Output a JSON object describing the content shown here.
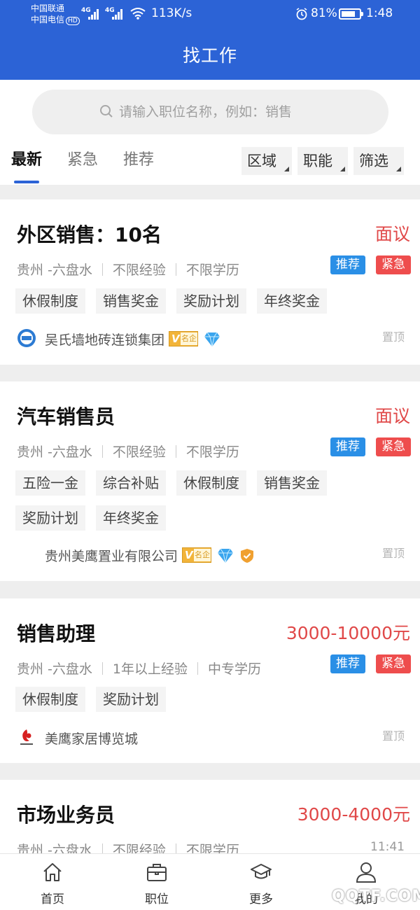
{
  "status_bar": {
    "carrier1": "中国联通",
    "carrier2": "中国电信",
    "hd": "HD",
    "net1": "4G",
    "net2": "4G",
    "speed": "113K/s",
    "battery_pct": "81%",
    "battery_level": 0.81,
    "time": "1:48"
  },
  "header": {
    "title": "找工作"
  },
  "search": {
    "placeholder": "请输入职位名称，例如：销售"
  },
  "tabs": [
    {
      "label": "最新",
      "active": true
    },
    {
      "label": "紧急",
      "active": false
    },
    {
      "label": "推荐",
      "active": false
    }
  ],
  "filters": [
    "区域",
    "职能",
    "筛选"
  ],
  "jobs": [
    {
      "title": "外区销售：10名",
      "salary": "面议",
      "location": "贵州 -六盘水",
      "experience": "不限经验",
      "education": "不限学历",
      "badges": [
        "推荐",
        "紧急"
      ],
      "tags": [
        "休假制度",
        "销售奖金",
        "奖励计划",
        "年终奖金"
      ],
      "company": "吴氏墙地砖连锁集团",
      "cert": "名企",
      "top_label": "置顶"
    },
    {
      "title": "汽车销售员",
      "salary": "面议",
      "location": "贵州 -六盘水",
      "experience": "不限经验",
      "education": "不限学历",
      "badges": [
        "推荐",
        "紧急"
      ],
      "tags": [
        "五险一金",
        "综合补贴",
        "休假制度",
        "销售奖金",
        "奖励计划",
        "年终奖金"
      ],
      "company": "贵州美鹰置业有限公司",
      "cert": "名企",
      "top_label": "置顶"
    },
    {
      "title": "销售助理",
      "salary": "3000-10000元",
      "location": "贵州 -六盘水",
      "experience": "1年以上经验",
      "education": "中专学历",
      "badges": [
        "推荐",
        "紧急"
      ],
      "tags": [
        "休假制度",
        "奖励计划"
      ],
      "company": "美鹰家居博览城",
      "top_label": "置顶"
    },
    {
      "title": "市场业务员",
      "salary": "3000-4000元",
      "location": "贵州 -六盘水",
      "experience": "不限经验",
      "education": "不限学历",
      "time": "11:41"
    }
  ],
  "bottom_nav": [
    {
      "label": "首页",
      "icon": "home-icon"
    },
    {
      "label": "职位",
      "icon": "briefcase-icon"
    },
    {
      "label": "更多",
      "icon": "graduation-cap-icon"
    },
    {
      "label": "我的",
      "icon": "user-icon"
    }
  ],
  "watermark": "QQTF.COM",
  "colors": {
    "primary": "#2c63d6",
    "salary": "#e04848",
    "recommend": "#2a8fe6",
    "urgent": "#ee4d4d"
  }
}
